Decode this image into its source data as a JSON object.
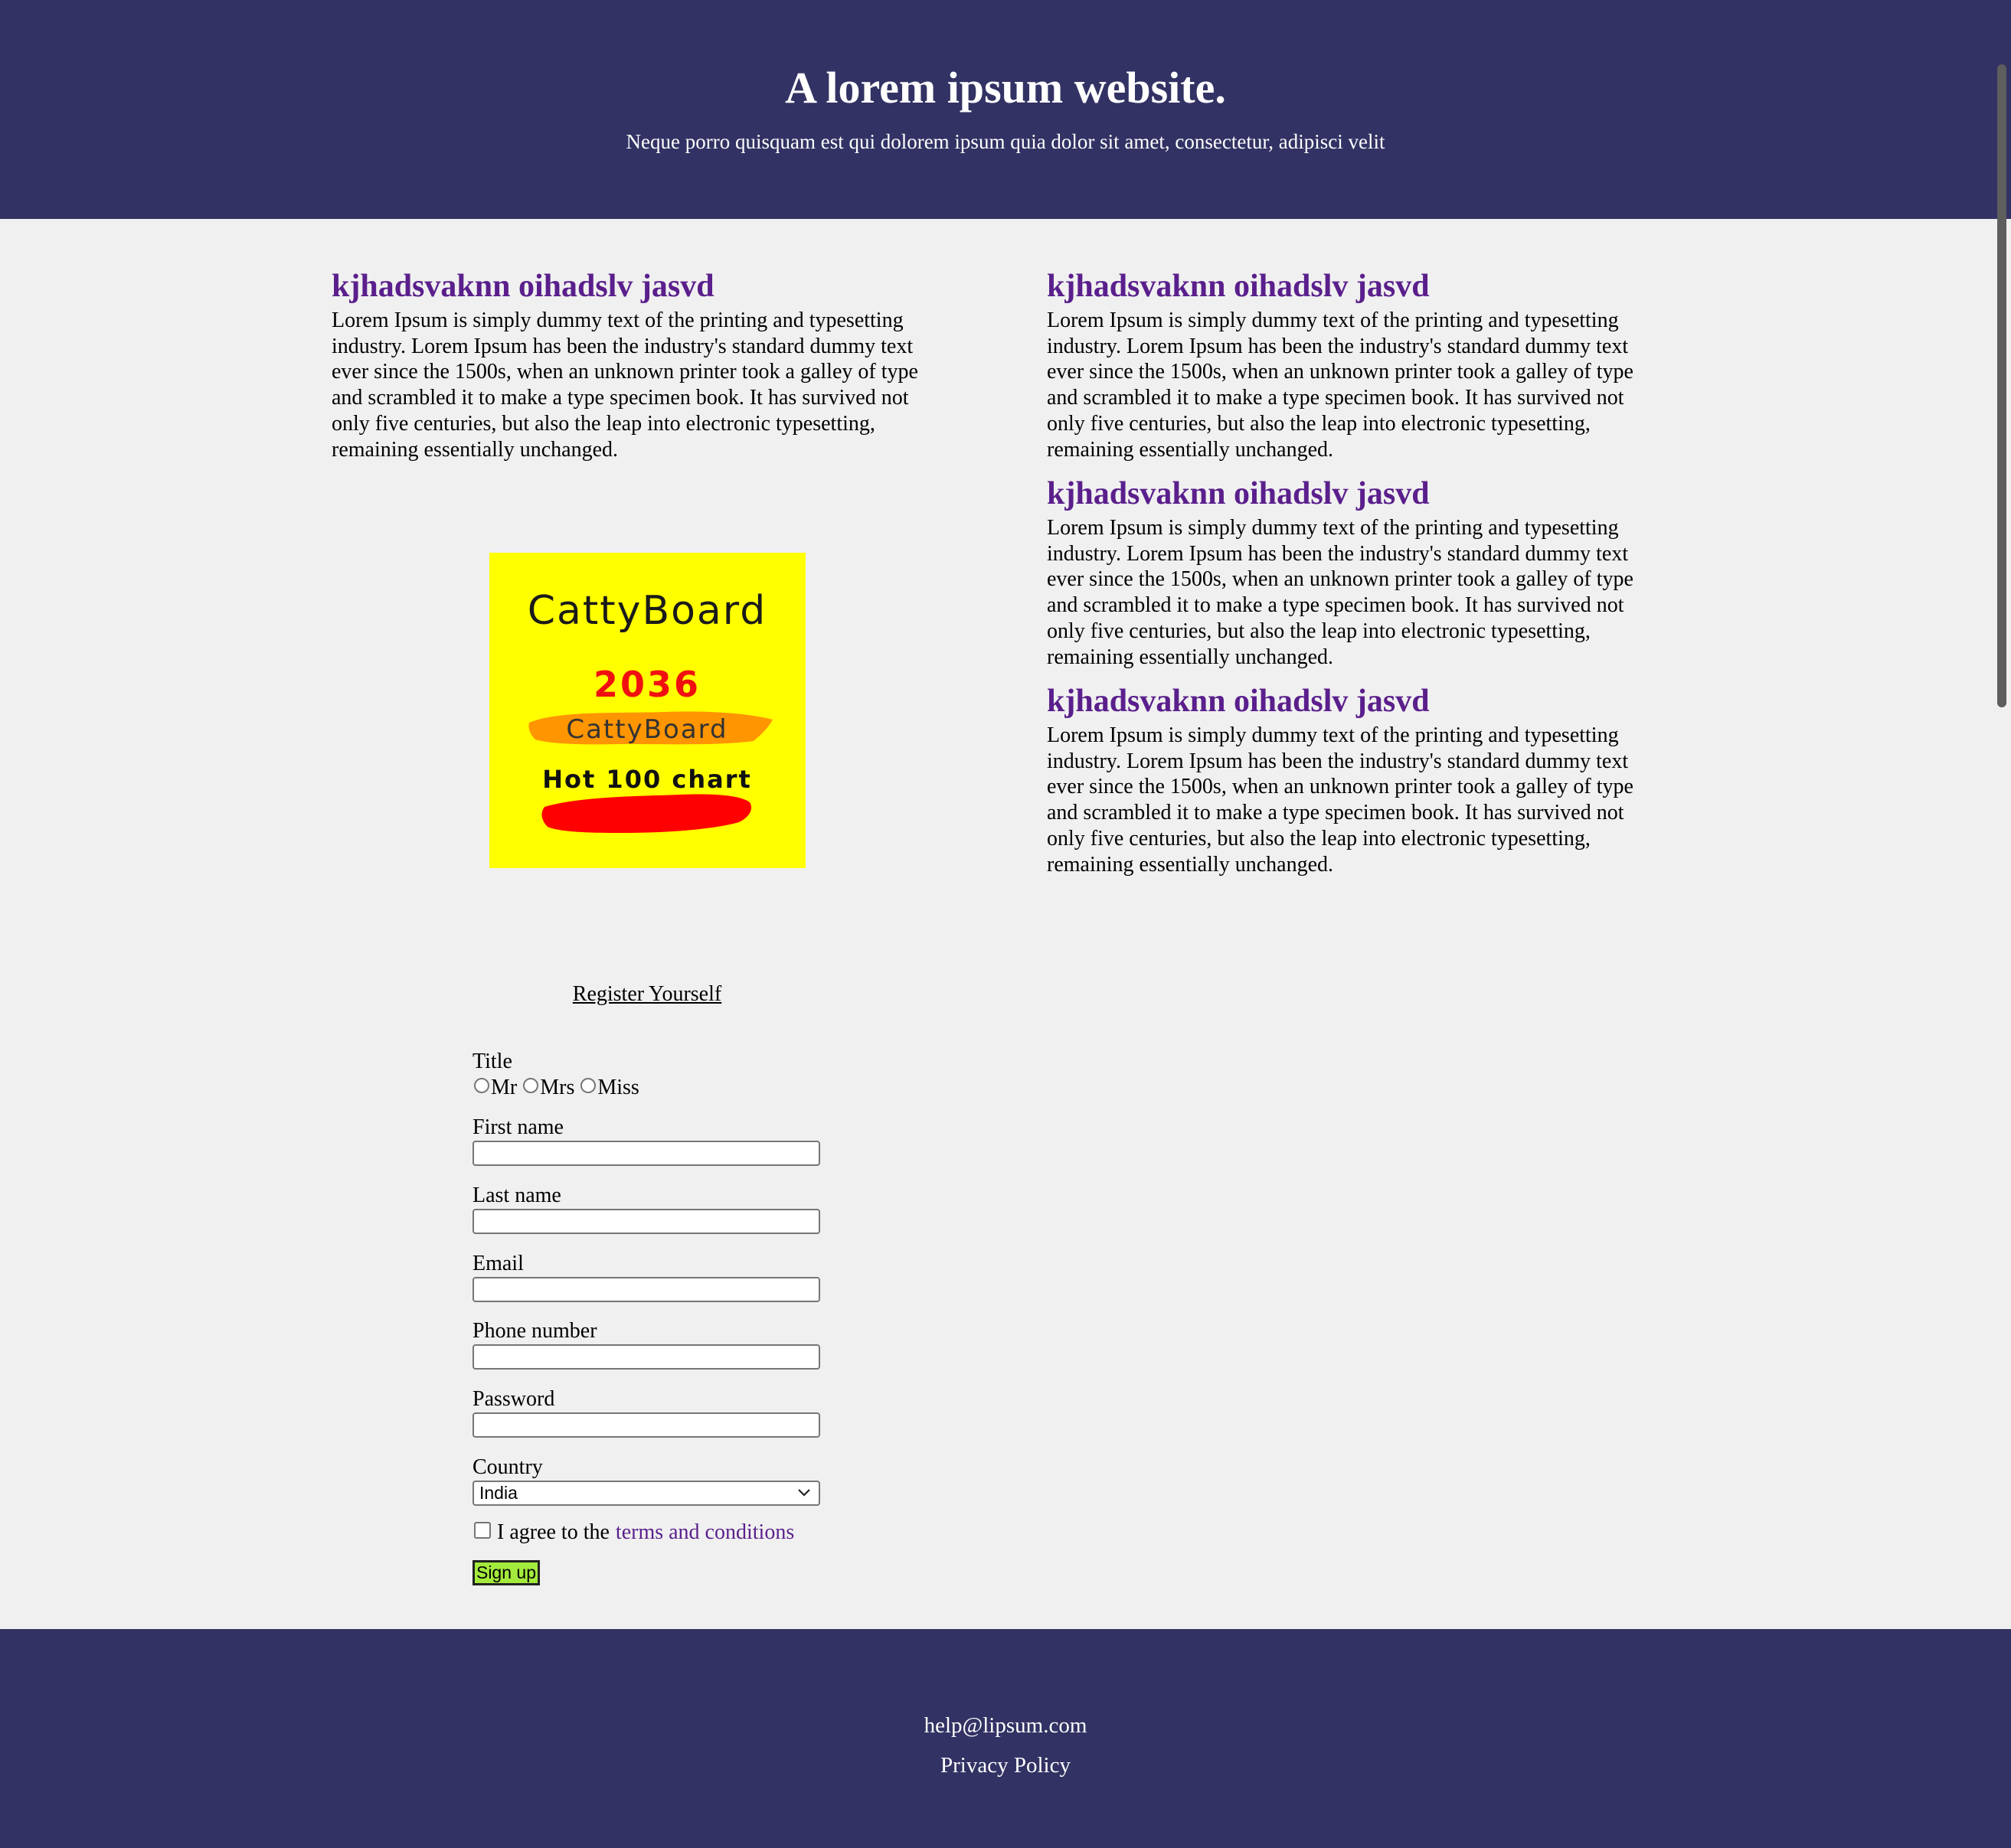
{
  "header": {
    "title": "A lorem ipsum website.",
    "subtitle": "Neque porro quisquam est qui dolorem ipsum quia dolor sit amet, consectetur, adipisci velit"
  },
  "articles": [
    {
      "heading": "kjhadsvaknn oihadslv jasvd",
      "body": "Lorem Ipsum is simply dummy text of the printing and typesetting industry. Lorem Ipsum has been the industry's standard dummy text ever since the 1500s, when an unknown printer took a galley of type and scrambled it to make a type specimen book. It has survived not only five centuries, but also the leap into electronic typesetting, remaining essentially unchanged."
    },
    {
      "heading": "kjhadsvaknn oihadslv jasvd",
      "body": "Lorem Ipsum is simply dummy text of the printing and typesetting industry. Lorem Ipsum has been the industry's standard dummy text ever since the 1500s, when an unknown printer took a galley of type and scrambled it to make a type specimen book. It has survived not only five centuries, but also the leap into electronic typesetting, remaining essentially unchanged."
    },
    {
      "heading": "kjhadsvaknn oihadslv jasvd",
      "body": "Lorem Ipsum is simply dummy text of the printing and typesetting industry. Lorem Ipsum has been the industry's standard dummy text ever since the 1500s, when an unknown printer took a galley of type and scrambled it to make a type specimen book. It has survived not only five centuries, but also the leap into electronic typesetting, remaining essentially unchanged."
    },
    {
      "heading": "kjhadsvaknn oihadslv jasvd",
      "body": "Lorem Ipsum is simply dummy text of the printing and typesetting industry. Lorem Ipsum has been the industry's standard dummy text ever since the 1500s, when an unknown printer took a galley of type and scrambled it to make a type specimen book. It has survived not only five centuries, but also the leap into electronic typesetting, remaining essentially unchanged."
    }
  ],
  "logo": {
    "brand": "CattyBoard",
    "year": "2036",
    "subbrand": "CattyBoard",
    "tagline": "Hot 100 chart",
    "colors": {
      "background": "#ffff00",
      "year": "#f01010",
      "orange_stroke": "#ff8c00",
      "red_stroke": "#ff0000"
    }
  },
  "register": {
    "link_label": "Register Yourself"
  },
  "form": {
    "title_label": "Title",
    "title_options": [
      "Mr",
      "Mrs",
      "Miss"
    ],
    "first_name_label": "First name",
    "first_name_value": "",
    "last_name_label": "Last name",
    "last_name_value": "",
    "email_label": "Email",
    "email_value": "",
    "phone_label": "Phone number",
    "phone_value": "",
    "password_label": "Password",
    "password_value": "",
    "country_label": "Country",
    "country_selected": "India",
    "agree_text": "I agree to the",
    "terms_link": "terms and conditions",
    "submit_label": "Sign up"
  },
  "footer": {
    "email": "help@lipsum.com",
    "privacy_link": "Privacy Policy"
  },
  "colors": {
    "header_bg": "#323264",
    "page_bg": "#f0f0f0",
    "heading": "#5a1f8c",
    "link": "#5a1f8c",
    "button_bg": "#a4ea3c"
  }
}
